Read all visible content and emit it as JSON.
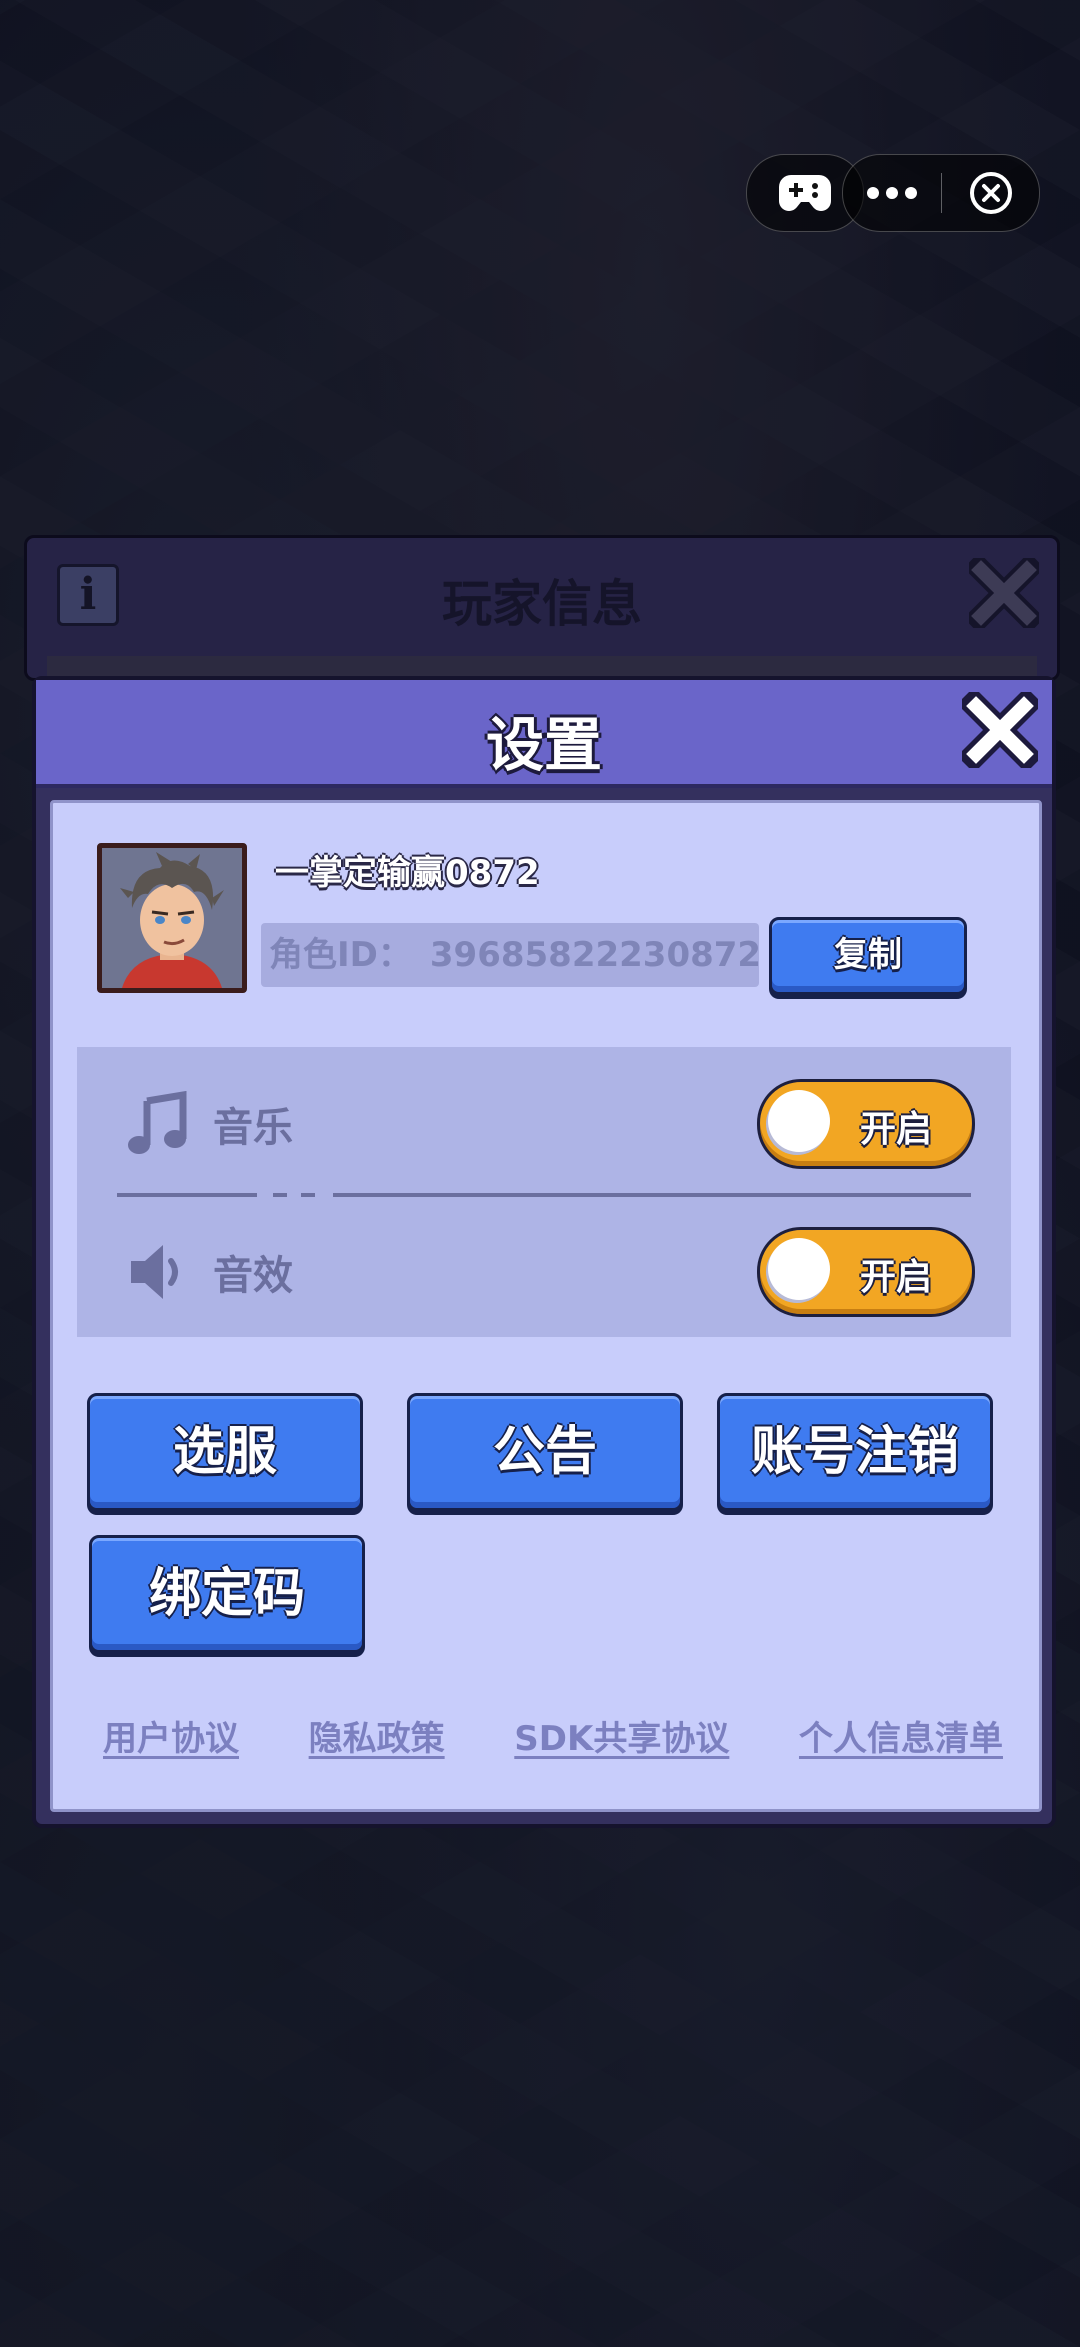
{
  "capsule": {
    "game_icon": "gamepad-icon",
    "more_icon": "more-dots-icon",
    "close_icon": "close-circle-icon"
  },
  "player_info_dialog": {
    "title": "玩家信息",
    "info_icon": "i",
    "close_icon": "close-x-icon"
  },
  "settings": {
    "title": "设置",
    "close_icon": "close-x-icon",
    "profile": {
      "nickname": "一掌定输赢0872",
      "role_id_label": "角色ID：",
      "role_id_value": "39685822230872",
      "copy_label": "复制",
      "avatar": "player-avatar"
    },
    "audio": {
      "music_label": "音乐",
      "music_toggle": "开启",
      "music_on": true,
      "sfx_label": "音效",
      "sfx_toggle": "开启",
      "sfx_on": true
    },
    "buttons": {
      "select_server": "选服",
      "announcement": "公告",
      "account_cancel": "账号注销",
      "bind_code": "绑定码"
    },
    "links": {
      "user_agreement": "用户协议",
      "privacy_policy": "隐私政策",
      "sdk_sharing": "SDK共享协议",
      "personal_info_list": "个人信息清单"
    }
  },
  "colors": {
    "header": "#6a65c9",
    "panel": "#c8cdfb",
    "button_blue": "#3f7bf0",
    "toggle_on": "#f2a623"
  }
}
